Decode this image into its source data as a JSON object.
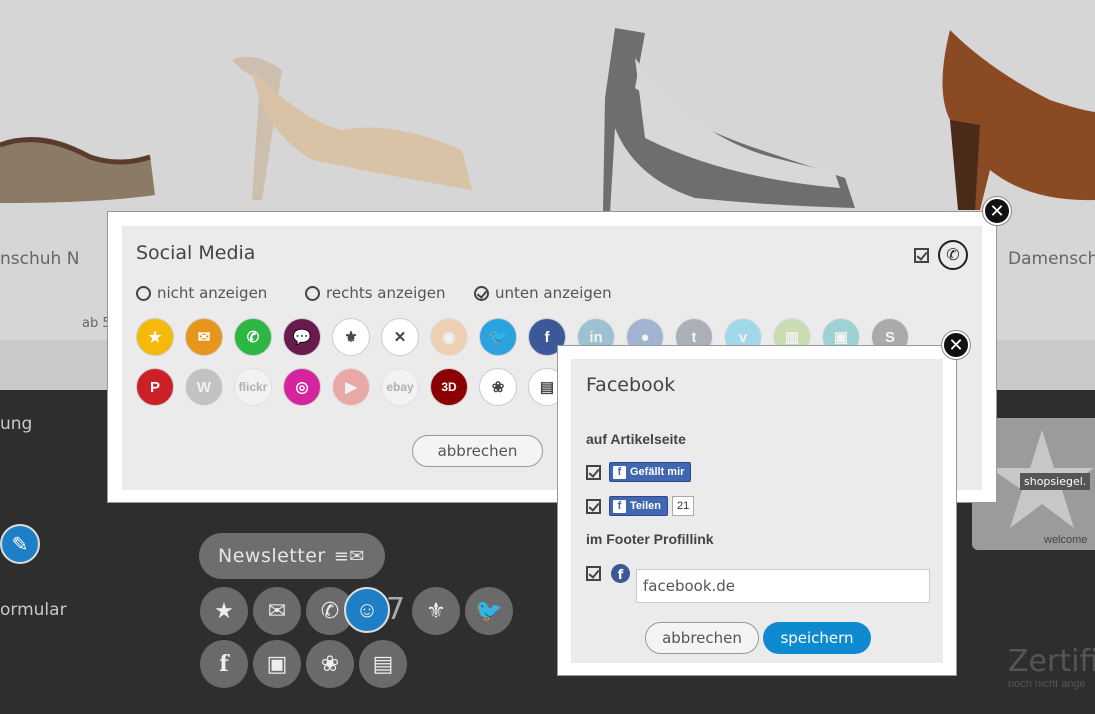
{
  "background": {
    "products": [
      {
        "name": "nschuh N",
        "price": "ab 5"
      },
      {
        "name": "Damensch"
      }
    ],
    "footer_links": [
      "ung",
      "ormular"
    ],
    "newsletter": {
      "label": "Newsletter",
      "icon": "envelope-icon"
    },
    "footer_icons": [
      "star-icon",
      "envelope-icon",
      "phone-icon",
      "community-icon",
      "fleur-de-lis-icon",
      "twitter-icon",
      "facebook-icon",
      "elephant-icon",
      "lotus-icon",
      "newspaper-icon"
    ],
    "footer_badge": "7",
    "seal": {
      "label": "shopsiegel.",
      "welcome": "welcome"
    },
    "certification": {
      "title": "Zertifik",
      "subtitle": "noch nicht ange"
    }
  },
  "social_modal": {
    "title": "Social Media",
    "header_icons": [
      "checkbox-icon",
      "phone-icon"
    ],
    "options": [
      {
        "label": "nicht anzeigen",
        "checked": false
      },
      {
        "label": "rechts anzeigen",
        "checked": false
      },
      {
        "label": "unten anzeigen",
        "checked": true
      }
    ],
    "icons_row1": [
      {
        "name": "star-icon",
        "color": "#f5b90b",
        "active": true
      },
      {
        "name": "mail-icon",
        "color": "#e8961b",
        "active": true
      },
      {
        "name": "whatsapp-icon",
        "color": "#2bb741",
        "active": true
      },
      {
        "name": "chat-icon",
        "color": "#6a1b4d",
        "active": true
      },
      {
        "name": "fleur-de-lis-icon",
        "color": "#ffffff",
        "active": true
      },
      {
        "name": "xing-icon",
        "color": "#ffffff",
        "active": true
      },
      {
        "name": "rss-icon",
        "color": "#f39c57",
        "active": false
      },
      {
        "name": "twitter-icon",
        "color": "#2aa3e0",
        "active": true
      },
      {
        "name": "facebook-icon",
        "color": "#3b5998",
        "active": true
      },
      {
        "name": "linkedin-icon",
        "color": "#0e76a8",
        "active": false
      },
      {
        "name": "myspace-icon",
        "color": "#1d4fa3",
        "active": false
      },
      {
        "name": "tumblr-icon",
        "color": "#35465c",
        "active": false
      },
      {
        "name": "vimeo-icon",
        "color": "#1ab7ea",
        "active": false
      },
      {
        "name": "stats-icon",
        "color": "#8bc34a",
        "active": false
      },
      {
        "name": "slideshare-icon",
        "color": "#0fa5a5",
        "active": false
      },
      {
        "name": "skype-icon",
        "color": "#333333",
        "active": false
      }
    ],
    "icons_row2": [
      {
        "name": "pinterest-icon",
        "color": "#cb2027",
        "active": true
      },
      {
        "name": "wordpress-icon",
        "color": "#777777",
        "active": false
      },
      {
        "name": "flickr-icon",
        "color": "#ffffff",
        "active": false,
        "text": "flickr"
      },
      {
        "name": "instagram-icon",
        "color": "#d6249f",
        "active": true
      },
      {
        "name": "youtube-icon",
        "color": "#e52d27",
        "active": false
      },
      {
        "name": "ebay-icon",
        "color": "#ffffff",
        "active": false,
        "text": "ebay"
      },
      {
        "name": "3d-icon",
        "color": "#8b0000",
        "active": true,
        "text": "3D"
      },
      {
        "name": "lotus-icon",
        "color": "#ffffff",
        "active": true
      },
      {
        "name": "newspaper-icon",
        "color": "#ffffff",
        "active": true
      }
    ],
    "cancel_label": "abbrechen"
  },
  "facebook_modal": {
    "title": "Facebook",
    "section_article": "auf Artikelseite",
    "like_label": "Gefällt mir",
    "share_label": "Teilen",
    "share_count": "21",
    "section_footer": "im Footer Profillink",
    "profile_value": "facebook.de",
    "cancel_label": "abbrechen",
    "save_label": "speichern",
    "colors": {
      "facebook_blue": "#4267b2",
      "save_button": "#0e8ad0"
    }
  }
}
